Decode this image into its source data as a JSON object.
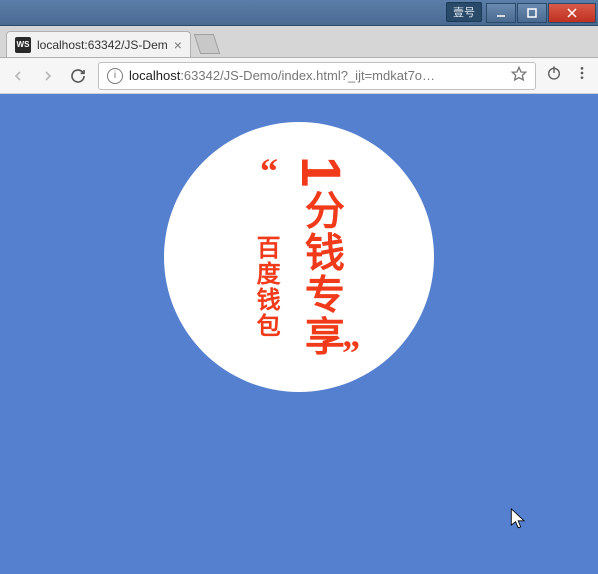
{
  "window": {
    "badge": "壹号",
    "controls": {
      "minimize": "min",
      "maximize": "max",
      "close": "close"
    }
  },
  "tab": {
    "favicon_text": "WS",
    "title": "localhost:63342/JS-Dem"
  },
  "toolbar": {
    "url_host": "localhost",
    "url_path": ":63342/JS-Demo/index.html?_ijt=mdkat7o…"
  },
  "content": {
    "quote_open": "“",
    "quote_close": "”",
    "main_digit": "1",
    "main_text": "分钱专享",
    "sub_text": "百度钱包",
    "bg_color": "#5580d0",
    "fg_color": "#f03a1a"
  }
}
